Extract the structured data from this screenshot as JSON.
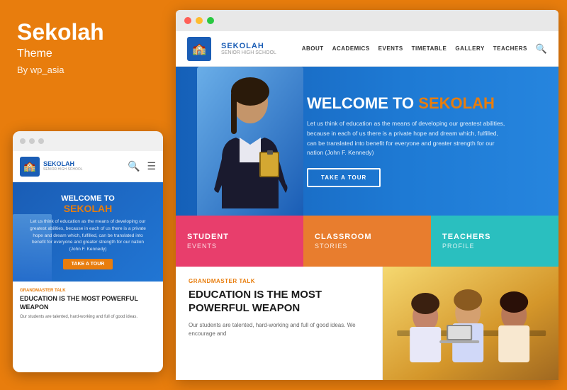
{
  "left": {
    "title": "Sekolah",
    "subtitle": "Theme",
    "author": "By wp_asia"
  },
  "mobile": {
    "dots": [
      "",
      "",
      ""
    ],
    "logo": {
      "name": "SEKOLAH",
      "sub": "SENIOR HIGH SCHOOL"
    },
    "hero": {
      "welcome": "WELCOME TO",
      "sekolah": "SEKOLAH",
      "desc": "Let us think of education as the means of developing our greatest abilities, because in each of us there is a private hope and dream which, fulfilled, can be translated into benefit for everyone and greater strength for our nation (John F. Kennedy)",
      "btn": "TAKE A TOUR"
    },
    "bottom": {
      "tag": "Grandmaster Talk",
      "heading": "EDUCATION IS THE MOST POWERFUL WEAPON",
      "text": "Our students are talented, hard-working and full of good ideas."
    }
  },
  "browser": {
    "nav": {
      "logo_name": "SEKOLAH",
      "logo_sub": "SENIOR HIGH SCHOOL",
      "links": [
        "ABOUT",
        "ACADEMICS",
        "EVENTS",
        "TIMETABLE",
        "GALLERY",
        "TEACHERS"
      ]
    },
    "hero": {
      "welcome": "WELCOME TO",
      "sekolah": "SEKOLAH",
      "desc": "Let us think of education as the means of developing our greatest abilities, because in each of us there is a private hope and dream which, fulfilled, can be translated into benefit for everyone and greater strength for our nation (John F. Kennedy)",
      "btn": "TAKE A TOUR"
    },
    "blocks": [
      {
        "title": "STUDENT",
        "sub": "EVENTS",
        "color": "pink"
      },
      {
        "title": "CLASSROOM",
        "sub": "STORIES",
        "color": "orange"
      },
      {
        "title": "TEACHERS",
        "sub": "PROFILE",
        "color": "teal"
      }
    ],
    "bottom": {
      "tag": "Grandmaster Talk",
      "heading_line1": "EDUCATION IS THE MOST",
      "heading_line2": "POWERFUL WEAPON",
      "text": "Our students are talented, hard-working and full of good ideas. We encourage and"
    }
  }
}
